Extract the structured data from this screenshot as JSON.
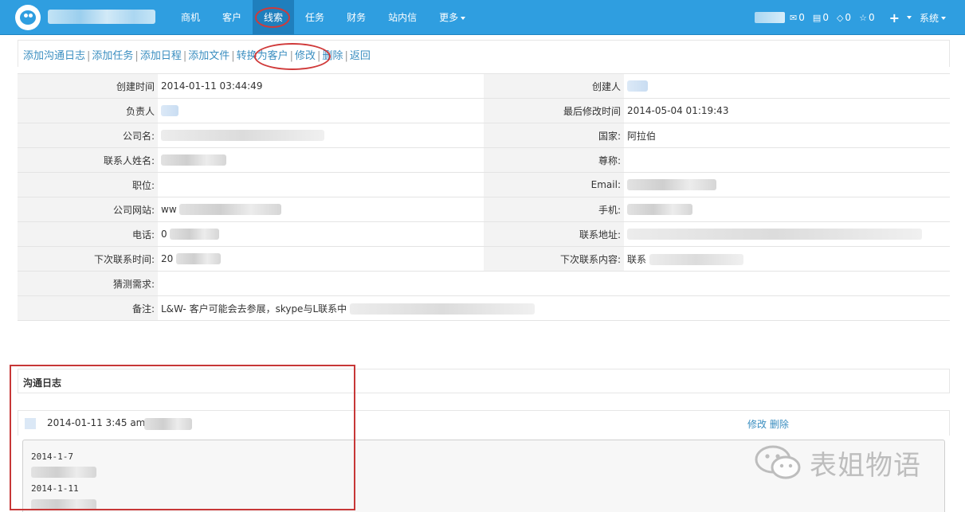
{
  "nav": {
    "items": [
      "商机",
      "客户",
      "线索",
      "任务",
      "财务",
      "站内信",
      "更多"
    ],
    "active": "线索"
  },
  "toolbar": {
    "messages": "0",
    "tasks": "0",
    "events": "0",
    "stars": "0",
    "add_icon": "plus-icon",
    "system_label": "系统"
  },
  "actions": {
    "add_log": "添加沟通日志",
    "add_task": "添加任务",
    "add_schedule": "添加日程",
    "add_file": "添加文件",
    "convert": "转换为客户",
    "edit": "修改",
    "delete": "删除",
    "back": "返回",
    "separator": "|"
  },
  "details": {
    "created_time_label": "创建时间",
    "created_time": "2014-01-11 03:44:49",
    "creator_label": "创建人",
    "owner_label": "负责人",
    "modified_label": "最后修改时间",
    "modified_time": "2014-05-04 01:19:43",
    "company_label": "公司名:",
    "country_label": "国家:",
    "country": "阿拉伯",
    "contact_label": "联系人姓名:",
    "salutation_label": "尊称:",
    "position_label": "职位:",
    "email_label": "Email:",
    "website_label": "公司网站:",
    "website_prefix": "ww",
    "mobile_label": "手机:",
    "phone_label": "电话:",
    "phone_prefix": "0",
    "address_label": "联系地址:",
    "next_time_label": "下次联系时间:",
    "next_time_prefix": "20",
    "next_content_label": "下次联系内容:",
    "next_content_prefix": "联系",
    "needs_label": "猜测需求:",
    "notes_label": "备注:",
    "notes": "L&W- 客户可能会去参展，skype与L联系中"
  },
  "log": {
    "title": "沟通日志",
    "entry_time": "2014-01-11 3:45 am",
    "edit": "修改",
    "delete": "删除",
    "lines": [
      "2014-1-7",
      "2014-1-11"
    ]
  },
  "watermark": {
    "text": "表姐物语",
    "icon": "wechat-icon"
  },
  "colors": {
    "topbar": "#2f9ee0",
    "active_nav": "#1f7fbd",
    "link": "#3a8ec0",
    "highlight": "#c73737"
  }
}
